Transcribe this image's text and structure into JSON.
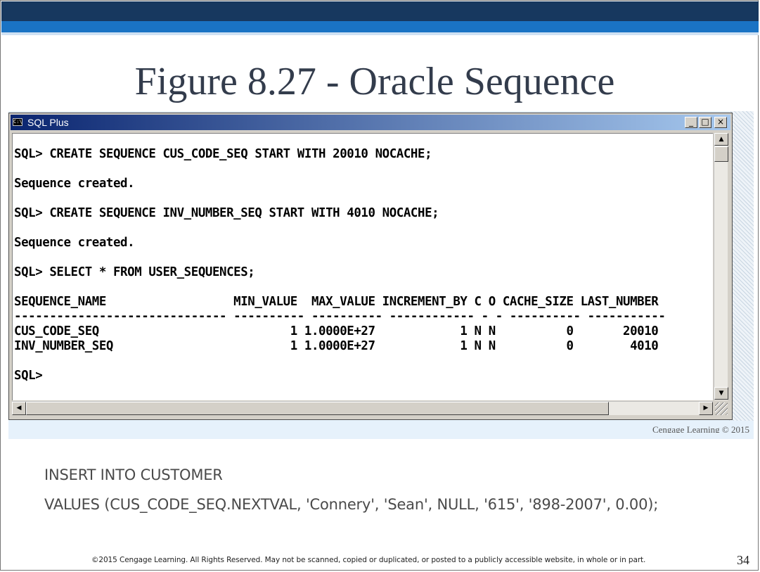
{
  "slide": {
    "title": "Figure 8.27 - Oracle Sequence",
    "credit": "Cengage Learning © 2015",
    "code_lines": [
      "INSERT INTO CUSTOMER",
      "VALUES (CUS_CODE_SEQ.NEXTVAL, 'Connery', 'Sean', NULL, '615', '898-2007', 0.00);"
    ],
    "footer": "©2015 Cengage Learning. All Rights Reserved. May not be scanned, copied or duplicated, or posted to a publicly accessible website, in whole or in part.",
    "page_number": "34"
  },
  "window": {
    "title": "SQL Plus",
    "icon": "console-icon",
    "buttons": {
      "minimize": "_",
      "maximize": "□",
      "close": "×"
    }
  },
  "console": {
    "lines": [
      "SQL> CREATE SEQUENCE CUS_CODE_SEQ START WITH 20010 NOCACHE;",
      "",
      "Sequence created.",
      "",
      "SQL> CREATE SEQUENCE INV_NUMBER_SEQ START WITH 4010 NOCACHE;",
      "",
      "Sequence created.",
      "",
      "SQL> SELECT * FROM USER_SEQUENCES;",
      "",
      "SEQUENCE_NAME                  MIN_VALUE  MAX_VALUE INCREMENT_BY C O CACHE_SIZE LAST_NUMBER",
      "------------------------------ ---------- ---------- ------------ - - ---------- -----------",
      "CUS_CODE_SEQ                           1 1.0000E+27            1 N N          0       20010",
      "INV_NUMBER_SEQ                         1 1.0000E+27            1 N N          0        4010",
      "",
      "SQL>"
    ]
  },
  "scrollbars": {
    "up": "▲",
    "down": "▼",
    "left": "◀",
    "right": "▶"
  }
}
